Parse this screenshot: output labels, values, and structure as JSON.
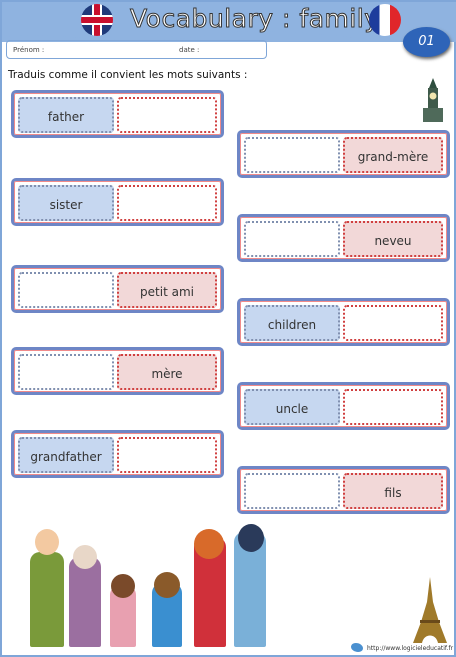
{
  "header": {
    "title": "Vocabulary : family",
    "number": "01",
    "firstname_label": "Prénom :",
    "date_label": "date :"
  },
  "instruction": "Traduis comme il convient les mots suivants :",
  "left_cards": [
    {
      "left": "father",
      "right": "",
      "filled": "left"
    },
    {
      "left": "sister",
      "right": "",
      "filled": "left"
    },
    {
      "left": "",
      "right": "petit ami",
      "filled": "right"
    },
    {
      "left": "",
      "right": "mère",
      "filled": "right"
    },
    {
      "left": "grandfather",
      "right": "",
      "filled": "left"
    }
  ],
  "right_cards": [
    {
      "left": "",
      "right": "grand-mère",
      "filled": "right"
    },
    {
      "left": "",
      "right": "neveu",
      "filled": "right"
    },
    {
      "left": "children",
      "right": "",
      "filled": "left"
    },
    {
      "left": "uncle",
      "right": "",
      "filled": "left"
    },
    {
      "left": "",
      "right": "fils",
      "filled": "right"
    }
  ],
  "footer": {
    "url": "http://www.logicieleducatif.fr"
  }
}
